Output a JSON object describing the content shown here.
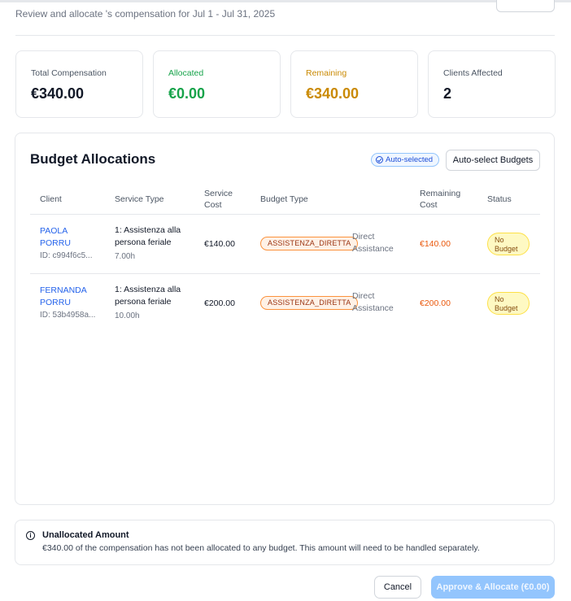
{
  "header": {
    "subtitle": "Review and allocate 's compensation for Jul 1 - Jul 31, 2025"
  },
  "stats": [
    {
      "label": "Total Compensation",
      "value": "€340.00"
    },
    {
      "label": "Allocated",
      "value": "€0.00",
      "color": "#16a34a"
    },
    {
      "label": "Remaining",
      "value": "€340.00",
      "color": "#ca8a04"
    },
    {
      "label": "Clients Affected",
      "value": "2"
    }
  ],
  "allocations": {
    "title": "Budget Allocations",
    "auto_badge": "Auto-selected",
    "auto_button": "Auto-select Budgets",
    "columns": {
      "client": "Client",
      "service_type": "Service Type",
      "service_cost_1": "Service",
      "service_cost_2": "Cost",
      "budget_type": "Budget Type",
      "remaining_1": "Remaining",
      "remaining_2": "Cost",
      "status": "Status"
    },
    "rows": [
      {
        "client_first": "PAOLA",
        "client_last": "PORRU",
        "client_id": "ID: c994f6c5...",
        "service_1": "1: Assistenza alla",
        "service_2": "persona feriale",
        "hours": "7.00h",
        "cost": "€140.00",
        "budget_badge": "ASSISTENZA_DIRETTA",
        "budget_desc_1": "Direct",
        "budget_desc_2": "Assistance",
        "remaining": "€140.00",
        "status_1": "No",
        "status_2": "Budget"
      },
      {
        "client_first": "FERNANDA",
        "client_last": "PORRU",
        "client_id": "ID: 53b4958a...",
        "service_1": "1: Assistenza alla",
        "service_2": "persona feriale",
        "hours": "10.00h",
        "cost": "€200.00",
        "budget_badge": "ASSISTENZA_DIRETTA",
        "budget_desc_1": "Direct",
        "budget_desc_2": "Assistance",
        "remaining": "€200.00",
        "status_1": "No",
        "status_2": "Budget"
      }
    ]
  },
  "note": {
    "icon": "info-icon",
    "title": "Unallocated Amount",
    "text": "€340.00 of the compensation has not been allocated to any budget. This amount will need to be handled separately."
  },
  "footer": {
    "cancel": "Cancel",
    "approve": "Approve & Allocate (€0.00)"
  }
}
